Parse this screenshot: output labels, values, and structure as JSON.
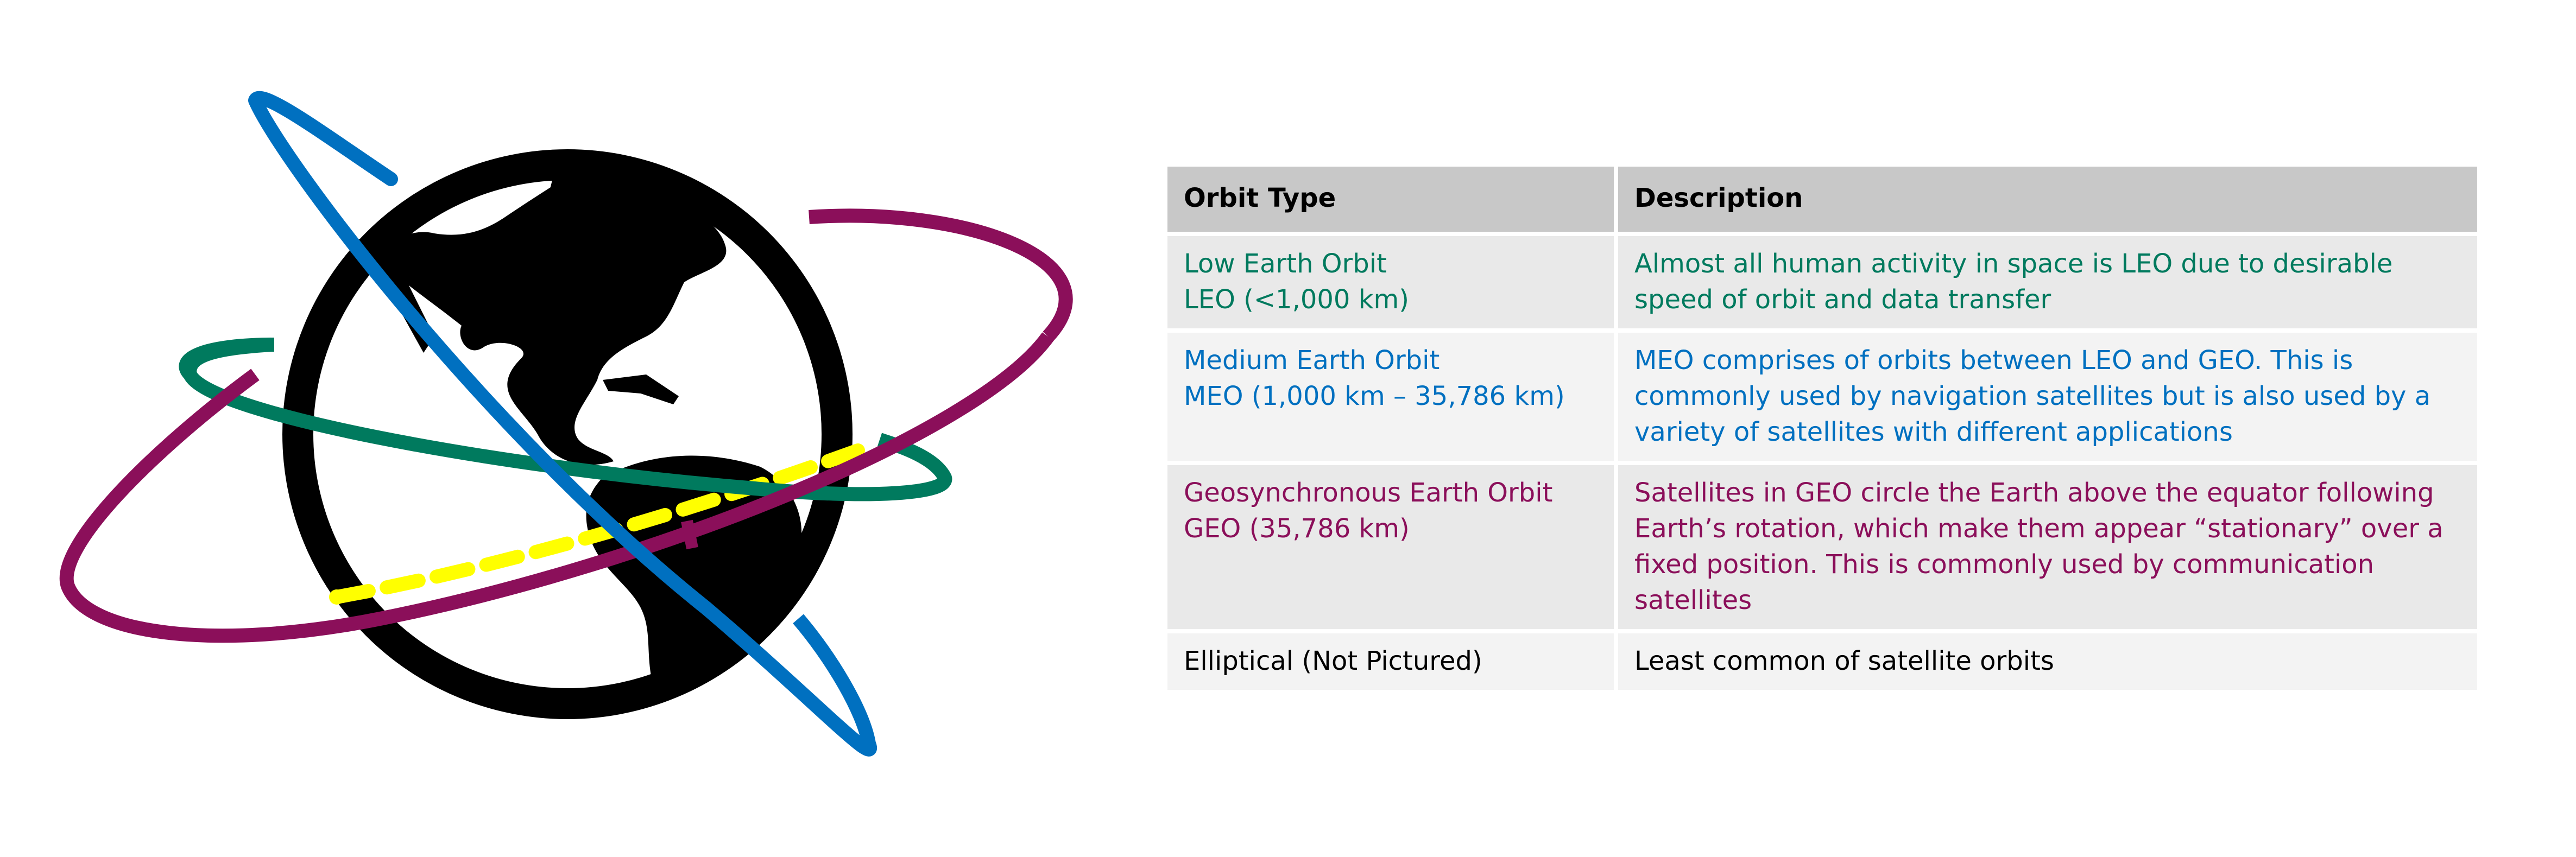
{
  "table": {
    "headers": [
      "Orbit Type",
      "Description"
    ],
    "rows": [
      {
        "type_lines": [
          "Low Earth Orbit",
          "LEO (<1,000 km)"
        ],
        "description": "Almost all human activity in space is LEO due to desirable speed of orbit and data transfer",
        "color": "#007a5e"
      },
      {
        "type_lines": [
          "Medium Earth Orbit",
          "MEO (1,000 km – 35,786 km)"
        ],
        "description": "MEO comprises of orbits between LEO and GEO. This is commonly used by navigation satellites but is also used by a variety of satellites with different applications",
        "color": "#0070c0"
      },
      {
        "type_lines": [
          "Geosynchronous Earth Orbit",
          "GEO (35,786 km)"
        ],
        "description": "Satellites in GEO circle the Earth above the equator following Earth’s rotation, which make them appear “stationary” over a fixed position. This is commonly used by communication satellites",
        "color": "#8b0f5a"
      },
      {
        "type_lines": [
          "Elliptical (Not Pictured)"
        ],
        "description": "Least common of satellite orbits",
        "color": "#000000"
      }
    ]
  },
  "figure": {
    "orbit_colors": {
      "leo": "#007a5e",
      "meo": "#0070c0",
      "geo": "#8b0f5a",
      "equator": "#ffff00",
      "earth": "#000000"
    }
  }
}
